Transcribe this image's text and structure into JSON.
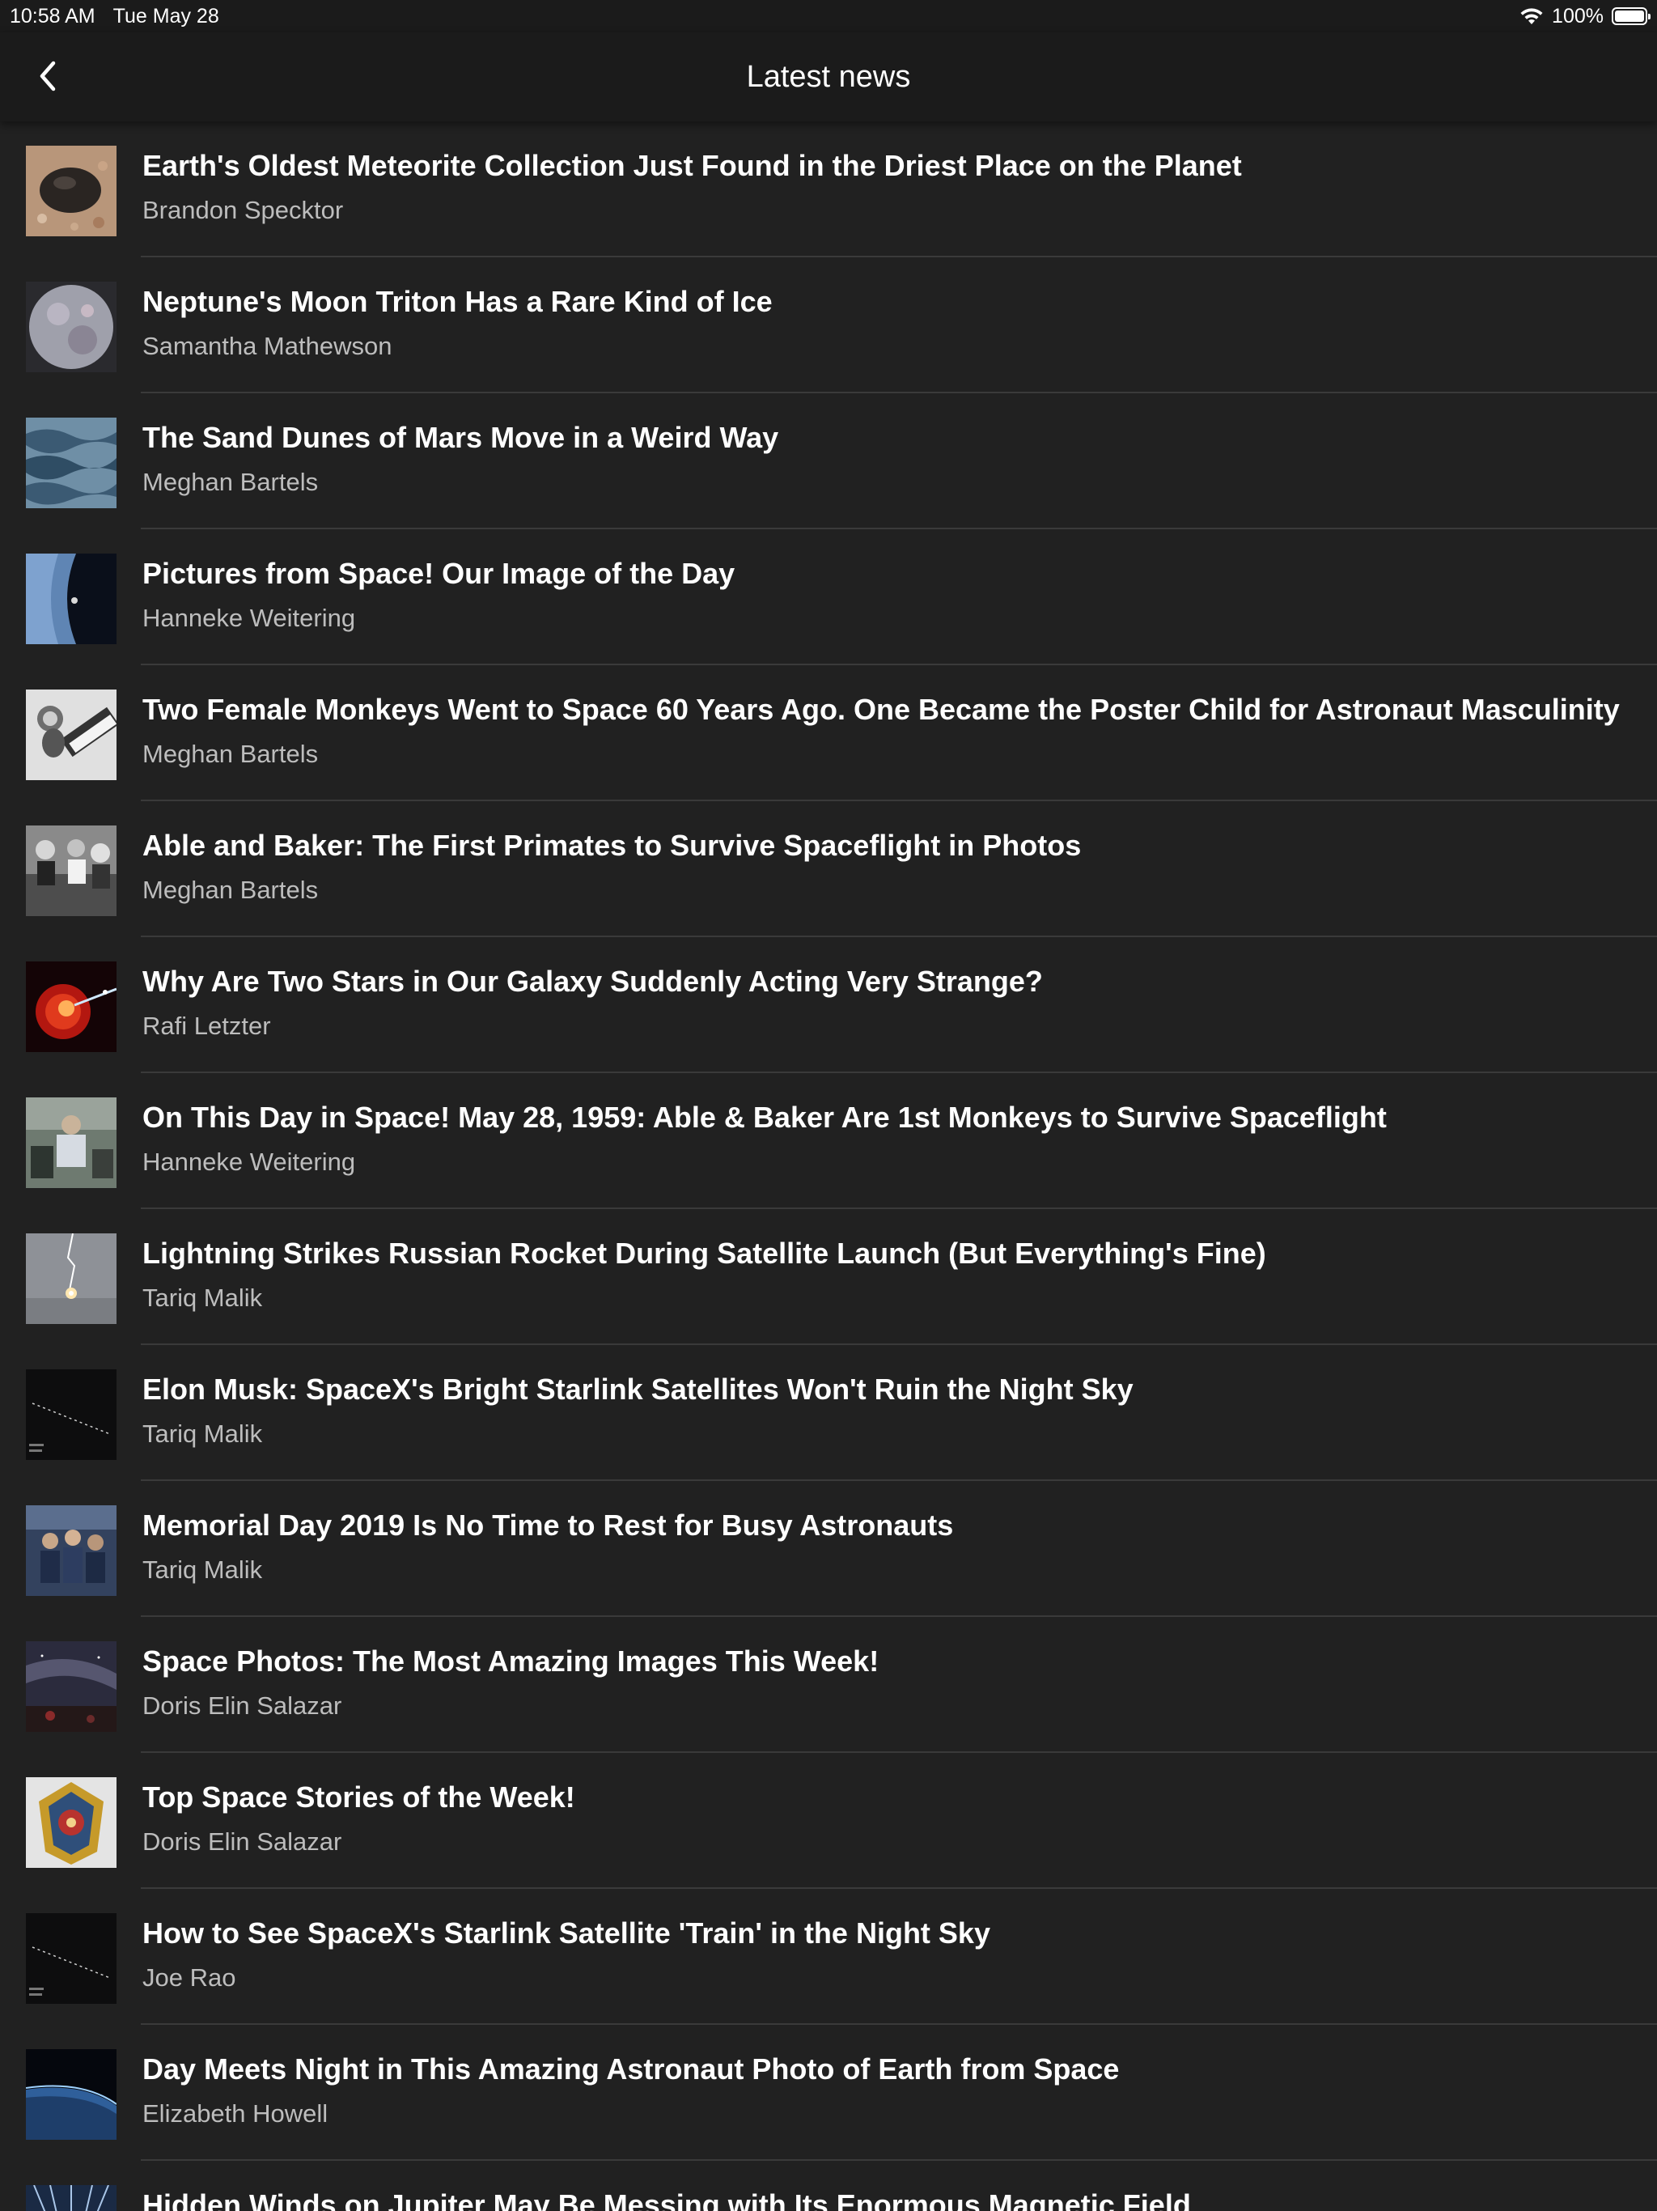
{
  "status_bar": {
    "time": "10:58 AM",
    "date": "Tue May 28",
    "battery": "100%"
  },
  "nav": {
    "title": "Latest news",
    "back_icon": "chevron-left-icon"
  },
  "colors": {
    "background": "#212121",
    "bar": "#1b1b1b",
    "headline": "#ffffff",
    "author": "#bdbdbd",
    "divider": "#3a3a3a"
  },
  "articles": [
    {
      "title": "Earth's Oldest Meteorite Collection Just Found in the Driest Place on the Planet",
      "author": "Brandon Specktor",
      "thumb": "meteorite-rock"
    },
    {
      "title": "Neptune's Moon Triton Has a Rare Kind of Ice",
      "author": "Samantha Mathewson",
      "thumb": "moon-triton"
    },
    {
      "title": "The Sand Dunes of Mars Move in a Weird Way",
      "author": "Meghan Bartels",
      "thumb": "mars-dunes"
    },
    {
      "title": "Pictures from Space! Our Image of the Day",
      "author": "Hanneke Weitering",
      "thumb": "earth-horizon"
    },
    {
      "title": "Two Female Monkeys Went to Space 60 Years Ago. One Became the Poster Child for Astronaut Masculinity",
      "author": "Meghan Bartels",
      "thumb": "monkey-bw"
    },
    {
      "title": "Able and Baker: The First Primates to Survive Spaceflight in Photos",
      "author": "Meghan Bartels",
      "thumb": "primates-bw"
    },
    {
      "title": "Why Are Two Stars in Our Galaxy Suddenly Acting Very Strange?",
      "author": "Rafi Letzter",
      "thumb": "red-star"
    },
    {
      "title": "On This Day in Space! May 28, 1959: Able & Baker Are 1st Monkeys to Survive Spaceflight",
      "author": "Hanneke Weitering",
      "thumb": "historic-photo"
    },
    {
      "title": "Lightning Strikes Russian Rocket During Satellite Launch (But Everything's Fine)",
      "author": "Tariq Malik",
      "thumb": "lightning-rocket"
    },
    {
      "title": "Elon Musk: SpaceX's Bright Starlink Satellites Won't Ruin the Night Sky",
      "author": "Tariq Malik",
      "thumb": "starlink-train"
    },
    {
      "title": "Memorial Day 2019 Is No Time to Rest for Busy Astronauts",
      "author": "Tariq Malik",
      "thumb": "astronauts-iss"
    },
    {
      "title": "Space Photos: The Most Amazing Images This Week!",
      "author": "Doris Elin Salazar",
      "thumb": "night-sky"
    },
    {
      "title": "Top Space Stories of the Week!",
      "author": "Doris Elin Salazar",
      "thumb": "mission-patch"
    },
    {
      "title": "How to See SpaceX's Starlink Satellite 'Train' in the Night Sky",
      "author": "Joe Rao",
      "thumb": "starlink-train"
    },
    {
      "title": "Day Meets Night in This Amazing Astronaut Photo of Earth from Space",
      "author": "Elizabeth Howell",
      "thumb": "earth-limb"
    },
    {
      "title": "Hidden Winds on Jupiter May Be Messing with Its Enormous Magnetic Field",
      "author": "",
      "thumb": "jupiter-field"
    }
  ]
}
